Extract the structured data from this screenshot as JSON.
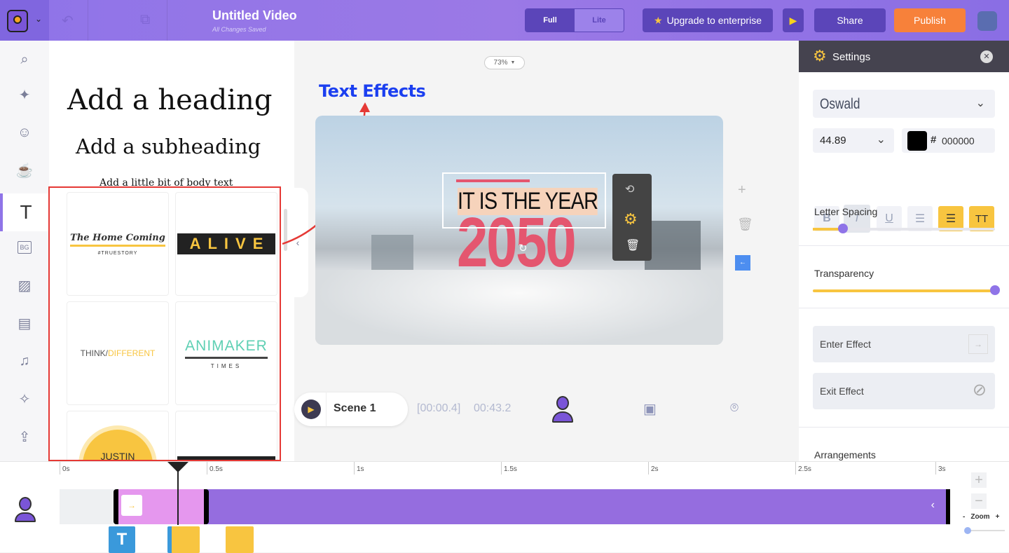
{
  "header": {
    "title": "Untitled Video",
    "status": "All Changes Saved",
    "mode_full": "Full",
    "mode_lite": "Lite",
    "upgrade": "Upgrade to enterprise",
    "share": "Share",
    "publish": "Publish"
  },
  "left_rail": {
    "items": [
      "search-icon",
      "scene-icon",
      "character-icon",
      "props-icon",
      "text-icon",
      "bg-icon",
      "image-icon",
      "video-icon",
      "music-icon",
      "effects-icon",
      "upload-icon"
    ],
    "bg_label": "BG"
  },
  "text_panel": {
    "heading": "Add a heading",
    "subheading": "Add a subheading",
    "body": "Add a little bit of body text",
    "templates": [
      {
        "title": "The Home Coming",
        "sub": "#TRUESTORY"
      },
      {
        "title": "ALIVE"
      },
      {
        "title_a": "THINK/",
        "title_b": "DIFFERENT"
      },
      {
        "title": "ANIMAKER",
        "sub": "TIMES"
      },
      {
        "title": "JUSTIN"
      },
      {
        "title": ""
      }
    ]
  },
  "canvas": {
    "zoom": "73%",
    "annotation": "Text Effects",
    "line1": "IT IS THE YEAR",
    "line2": "2050"
  },
  "scene_bar": {
    "scene": "Scene 1",
    "current": "[00:00.4]",
    "total": "00:43.2"
  },
  "settings": {
    "title": "Settings",
    "font": "Oswald",
    "size": "44.89",
    "color_hash": "#",
    "color": "000000",
    "format": [
      "B",
      "I",
      "U",
      "list",
      "align-center",
      "TT"
    ],
    "letter_spacing": "Letter Spacing",
    "letter_spacing_value": 0.15,
    "transparency": "Transparency",
    "transparency_value": 1.0,
    "enter_effect": "Enter Effect",
    "exit_effect": "Exit Effect",
    "arrangements": "Arrangements"
  },
  "timeline": {
    "ticks": [
      "0s",
      "0.5s",
      "1s",
      "1.5s",
      "2s",
      "2.5s",
      "3s"
    ],
    "zoom_label": "Zoom",
    "zoom_minus": "-",
    "zoom_plus": "+",
    "text_block": "T"
  },
  "colors": {
    "accent": "#8f74e8",
    "publish": "#f7813a",
    "yellow": "#f8c540",
    "pink": "#e4566f",
    "red_box": "#e53935"
  }
}
